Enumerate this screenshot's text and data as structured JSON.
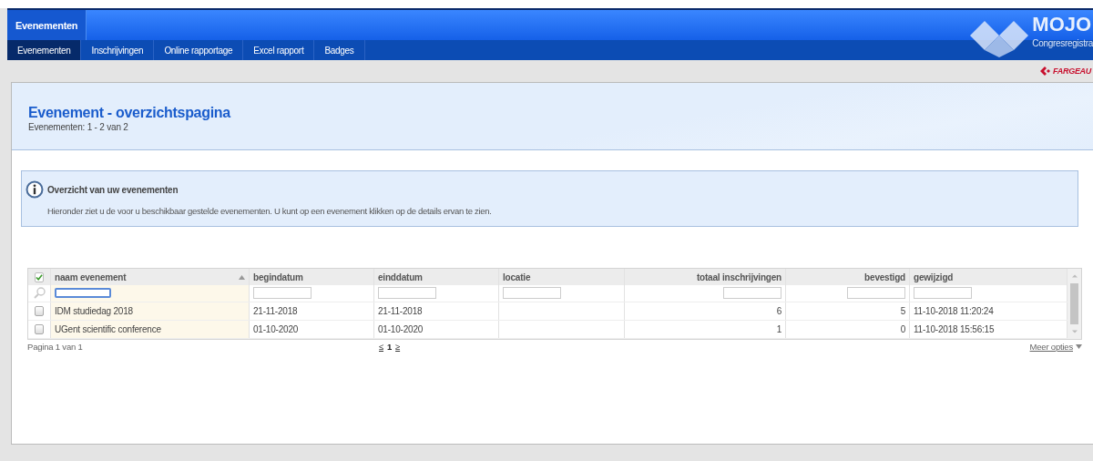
{
  "app": {
    "title": "Evenementen"
  },
  "nav": [
    {
      "label": "Evenementen",
      "selected": true
    },
    {
      "label": "Inschrijvingen",
      "selected": false
    },
    {
      "label": "Online rapportage",
      "selected": false
    },
    {
      "label": "Excel rapport",
      "selected": false
    },
    {
      "label": "Badges",
      "selected": false
    }
  ],
  "logo": {
    "name": "MOJO",
    "subtitle": "Congresregistra"
  },
  "partner": {
    "name": "FARGEAU"
  },
  "page": {
    "title": "Evenement - overzichtspagina",
    "subtitle": "Evenementen: 1 - 2 van 2"
  },
  "info": {
    "title": "Overzicht van uw evenementen",
    "text": "Hieronder ziet u de voor u beschikbaar gestelde evenementen. U kunt op een evenement klikken op de details ervan te zien."
  },
  "table": {
    "select_all": {
      "checked": true
    },
    "columns": [
      {
        "label": "naam evenement",
        "kind": "text",
        "sorted": true,
        "filter_focused": true
      },
      {
        "label": "begindatum",
        "kind": "text",
        "sorted": false,
        "filter_focused": false
      },
      {
        "label": "einddatum",
        "kind": "text",
        "sorted": false,
        "filter_focused": false
      },
      {
        "label": "locatie",
        "kind": "text",
        "sorted": false,
        "filter_focused": false
      },
      {
        "label": "totaal inschrijvingen",
        "kind": "number",
        "sorted": false,
        "filter_focused": false
      },
      {
        "label": "bevestigd",
        "kind": "number",
        "sorted": false,
        "filter_focused": false
      },
      {
        "label": "gewijzigd",
        "kind": "text",
        "sorted": false,
        "filter_focused": false
      }
    ],
    "rows": [
      {
        "selected": false,
        "cells": [
          "IDM studiedag 2018",
          "21-11-2018",
          "21-11-2018",
          "",
          "6",
          "5",
          "11-10-2018 11:20:24"
        ]
      },
      {
        "selected": false,
        "cells": [
          "UGent scientific conference",
          "01-10-2020",
          "01-10-2020",
          "",
          "1",
          "0",
          "11-10-2018 15:56:15"
        ]
      }
    ]
  },
  "pager": {
    "status": "Pagina 1 van 1",
    "prev": "≤",
    "page": "1",
    "next": "≥",
    "more": "Meer opties"
  }
}
